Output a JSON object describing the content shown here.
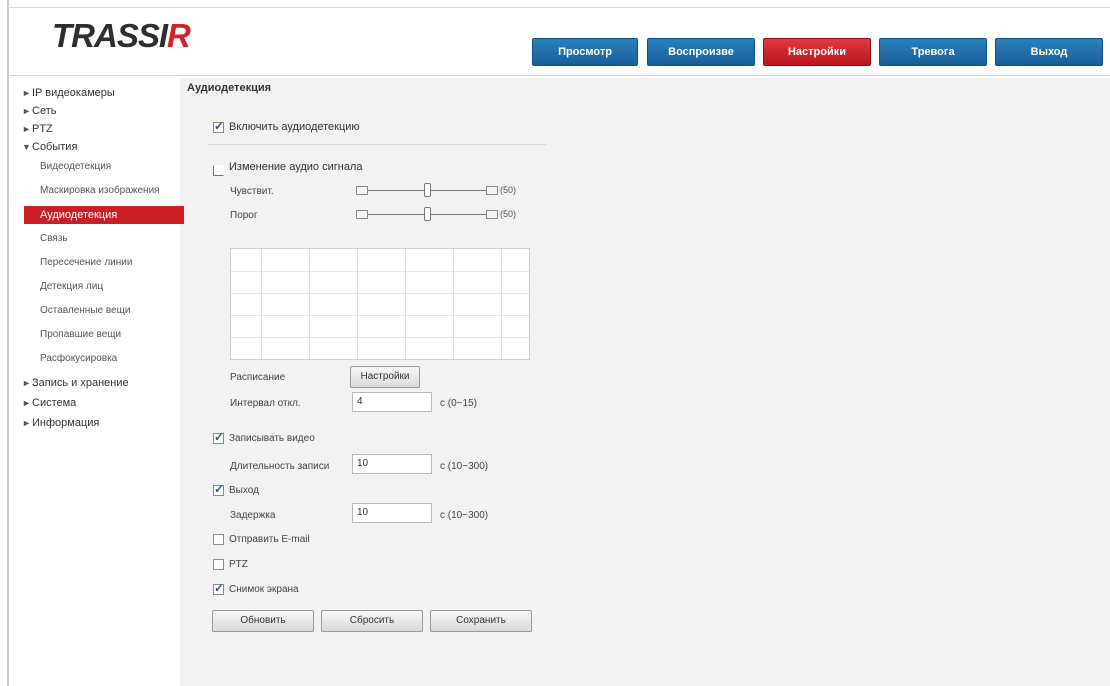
{
  "logo": {
    "text_main": "TRASSI",
    "text_accent": "R"
  },
  "topnav": [
    {
      "label": "Просмотр",
      "active": false
    },
    {
      "label": "Воспроизве",
      "active": false
    },
    {
      "label": "Настройки",
      "active": true
    },
    {
      "label": "Тревога",
      "active": false
    },
    {
      "label": "Выход",
      "active": false
    }
  ],
  "sidebar": {
    "items": [
      {
        "label": "IP видеокамеры",
        "arrow": "►"
      },
      {
        "label": "Сеть",
        "arrow": "►"
      },
      {
        "label": "PTZ",
        "arrow": "►"
      },
      {
        "label": "События",
        "arrow": "▼"
      },
      {
        "label": "Видеодетекция"
      },
      {
        "label": "Маскировка изображения"
      },
      {
        "label": "Аудиодетекция"
      },
      {
        "label": "Связь"
      },
      {
        "label": "Пересечение линии"
      },
      {
        "label": "Детекция лиц"
      },
      {
        "label": "Оставленные вещи"
      },
      {
        "label": "Пропавшие вещи"
      },
      {
        "label": "Расфокусировка"
      },
      {
        "label": "Запись и хранение",
        "arrow": "►"
      },
      {
        "label": "Система",
        "arrow": "►"
      },
      {
        "label": "Информация",
        "arrow": "►"
      }
    ]
  },
  "page": {
    "title": "Аудиодетекция",
    "enable_audio_label": "Включить аудиодетекцию",
    "audio_anomaly_label": "Изменение аудио сигнала",
    "sensitivity_label": "Чувствит.",
    "sensitivity_value": "(50)",
    "threshold_label": "Порог",
    "threshold_value": "(50)",
    "schedule_label": "Расписание",
    "schedule_button": "Настройки",
    "interval_label": "Интервал откл.",
    "interval_value": "4",
    "interval_unit": "с (0~15)",
    "record_label": "Записывать видео",
    "record_delay_label": "Длительность записи",
    "record_delay_value": "10",
    "record_delay_unit": "с (10~300)",
    "output_label": "Выход",
    "output_delay_label": "Задержка",
    "output_delay_value": "10",
    "output_delay_unit": "с (10~300)",
    "email_label": "Отправить E-mail",
    "ptz_label": "PTZ",
    "snapshot_label": "Снимок экрана",
    "buttons": {
      "refresh": "Обновить",
      "default": "Сбросить",
      "save": "Сохранить"
    }
  },
  "checkbox_states": {
    "enable_audio": true,
    "audio_anomaly": false,
    "record": true,
    "output": true,
    "email": false,
    "ptz": false,
    "snapshot": true
  },
  "sliders": {
    "sensitivity_level": 0.5,
    "threshold_level": 0.5
  }
}
